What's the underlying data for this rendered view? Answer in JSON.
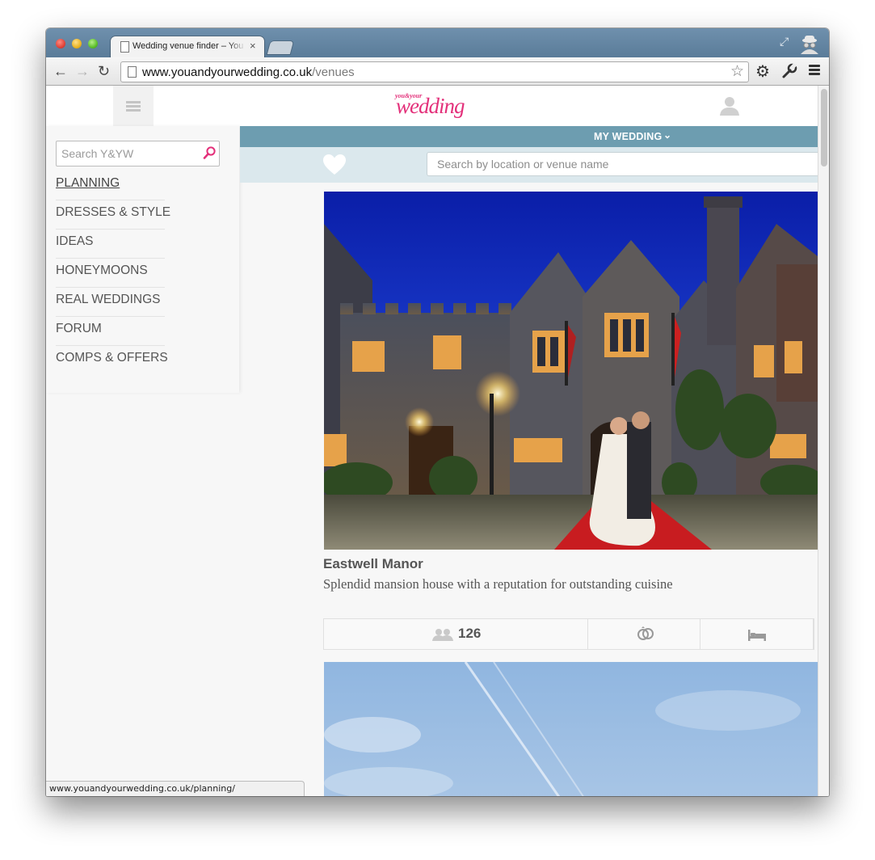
{
  "browser": {
    "tab_title": "Wedding venue finder – You and Your Wedding",
    "tab_close": "×",
    "url_host": "www.youandyourwedding.co.uk",
    "url_path": "/venues",
    "status_url": "www.youandyourwedding.co.uk/planning/"
  },
  "header": {
    "logo_small": "you&your",
    "logo_main": "wedding"
  },
  "sidebar": {
    "search_placeholder": "Search Y&YW",
    "items": [
      {
        "label": "PLANNING"
      },
      {
        "label": "DRESSES & STYLE"
      },
      {
        "label": "IDEAS"
      },
      {
        "label": "HONEYMOONS"
      },
      {
        "label": "REAL WEDDINGS"
      },
      {
        "label": "FORUM"
      },
      {
        "label": "COMPS & OFFERS"
      }
    ]
  },
  "mywedding": {
    "label": "MY WEDDING",
    "chevron": "⌄"
  },
  "venue_search": {
    "placeholder": "Search by location or venue name"
  },
  "venue": {
    "name": "Eastwell Manor",
    "description": "Splendid mansion house with a reputation for outstanding cuisine",
    "guest_capacity": "126"
  },
  "colors": {
    "brand_pink": "#e3307a",
    "mywedding_bar": "#6d9db0",
    "search_band": "#dbe8ed"
  },
  "icons": [
    "page-icon",
    "back-arrow-icon",
    "forward-arrow-icon",
    "reload-icon",
    "star-icon",
    "gear-icon",
    "wrench-icon",
    "menu-icon",
    "hamburger-icon",
    "user-icon",
    "magnifier-icon",
    "heart-icon",
    "guests-icon",
    "rings-icon",
    "bed-icon"
  ]
}
